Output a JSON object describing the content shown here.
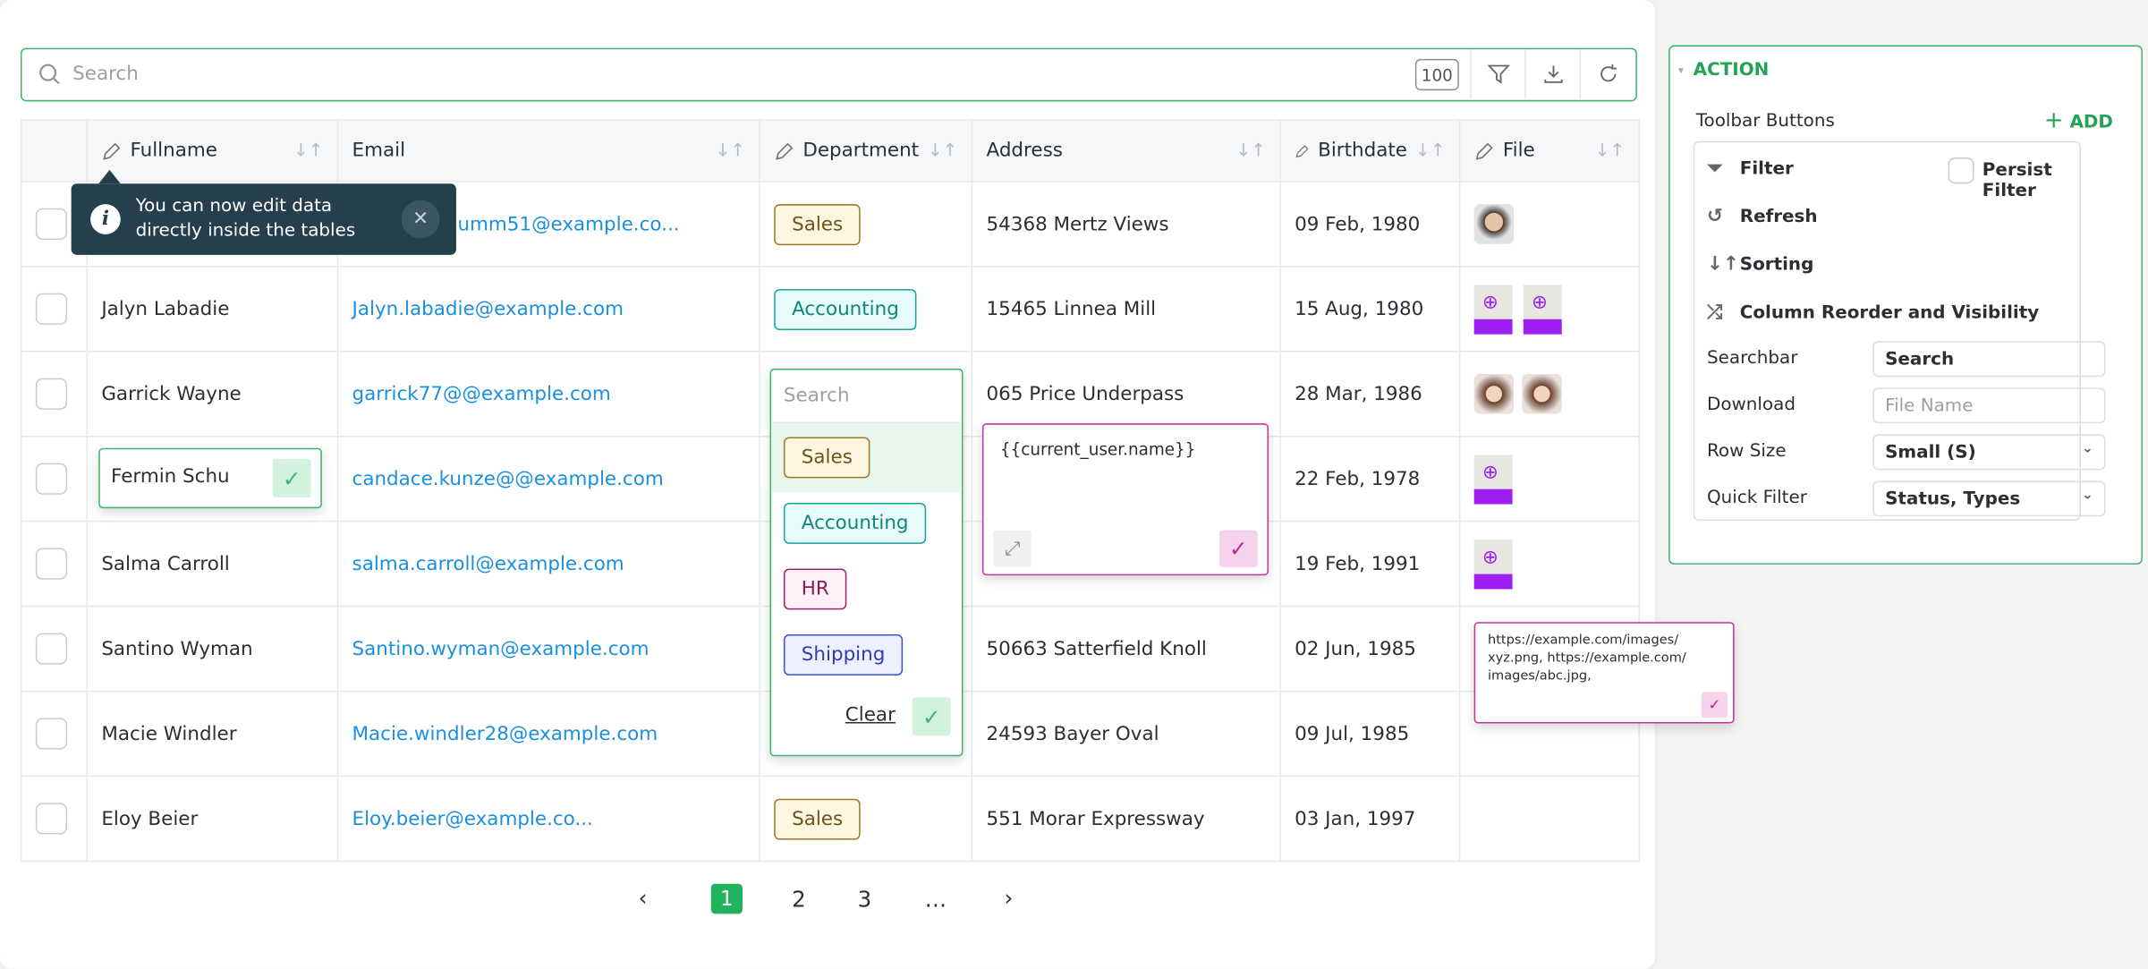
{
  "search": {
    "placeholder": "Search",
    "row_count": "100",
    "icons": [
      "filter-icon",
      "download-icon",
      "refresh-icon"
    ]
  },
  "columns": [
    {
      "label": "Fullname",
      "editable": true
    },
    {
      "label": "Email",
      "editable": false
    },
    {
      "label": "Department",
      "editable": true
    },
    {
      "label": "Address",
      "editable": false
    },
    {
      "label": "Birthdate",
      "editable": true
    },
    {
      "label": "File",
      "editable": true
    }
  ],
  "rows": [
    {
      "name": "",
      "email": "umm51@example.co...",
      "dept": "Sales",
      "address": "54368 Mertz Views",
      "birthdate": "09 Feb, 1980",
      "files": [
        "avatar-m"
      ]
    },
    {
      "name": "Jalyn Labadie",
      "email": "Jalyn.labadie@example.com",
      "dept": "Accounting",
      "address": "15465 Linnea Mill",
      "birthdate": "15 Aug, 1980",
      "files": [
        "url",
        "url"
      ]
    },
    {
      "name": "Garrick Wayne",
      "email": "garrick77@@example.com",
      "dept": "",
      "address": "065 Price Underpass",
      "birthdate": "28 Mar, 1986",
      "files": [
        "avatar-f",
        "avatar-f"
      ]
    },
    {
      "name": "",
      "email": "candace.kunze@@example.com",
      "dept": "",
      "address": "",
      "birthdate": "22 Feb, 1978",
      "files": [
        "url"
      ]
    },
    {
      "name": "Salma Carroll",
      "email": "salma.carroll@example.com",
      "dept": "",
      "address": "",
      "birthdate": "19 Feb, 1991",
      "files": [
        "url"
      ]
    },
    {
      "name": "Santino Wyman",
      "email": "Santino.wyman@example.com",
      "dept": "",
      "address": "50663 Satterfield Knoll",
      "birthdate": "02 Jun, 1985",
      "files": []
    },
    {
      "name": "Macie Windler",
      "email": "Macie.windler28@example.com",
      "dept": "",
      "address": "24593 Bayer Oval",
      "birthdate": "09 Jul, 1985",
      "files": []
    },
    {
      "name": "Eloy Beier",
      "email": "Eloy.beier@example.co...",
      "dept": "Sales",
      "address": "551 Morar Expressway",
      "birthdate": "03 Jan, 1997",
      "files": []
    }
  ],
  "tooltip": {
    "text_line1": "You can now edit data",
    "text_line2": "directly inside the tables"
  },
  "name_editor": {
    "value": "Fermin Schu"
  },
  "dept_dropdown": {
    "search_placeholder": "Search",
    "options": [
      "Sales",
      "Accounting",
      "HR",
      "Shipping"
    ],
    "highlighted": "Sales",
    "clear_label": "Clear"
  },
  "text_editor": {
    "value": "{{current_user.name}}"
  },
  "url_editor": {
    "line1": "https://example.com/images/",
    "line2": "xyz.png, https://example.com/",
    "line3": "images/abc.jpg,"
  },
  "pagination": {
    "pages": [
      "1",
      "2",
      "3",
      "…"
    ],
    "current": "1"
  },
  "panel": {
    "title": "ACTION",
    "toolbar_label": "Toolbar Buttons",
    "add_label": "ADD",
    "buttons": [
      "Filter",
      "Refresh",
      "Sorting",
      "Column Reorder and Visibility"
    ],
    "persist_filter": "Persist Filter",
    "persist_checked": false,
    "fields": [
      {
        "label": "Searchbar",
        "value": "Search",
        "placeholder": ""
      },
      {
        "label": "Download",
        "value": "",
        "placeholder": "File Name"
      },
      {
        "label": "Row Size",
        "value": "Small (S)",
        "dropdown": true
      },
      {
        "label": "Quick Filter",
        "value": "Status, Types",
        "dropdown": true
      }
    ]
  },
  "colors": {
    "accent": "#3cb46e",
    "link": "#1a8fe0",
    "tooltip_bg": "#263f4c",
    "editor_border": "#c035a0"
  }
}
